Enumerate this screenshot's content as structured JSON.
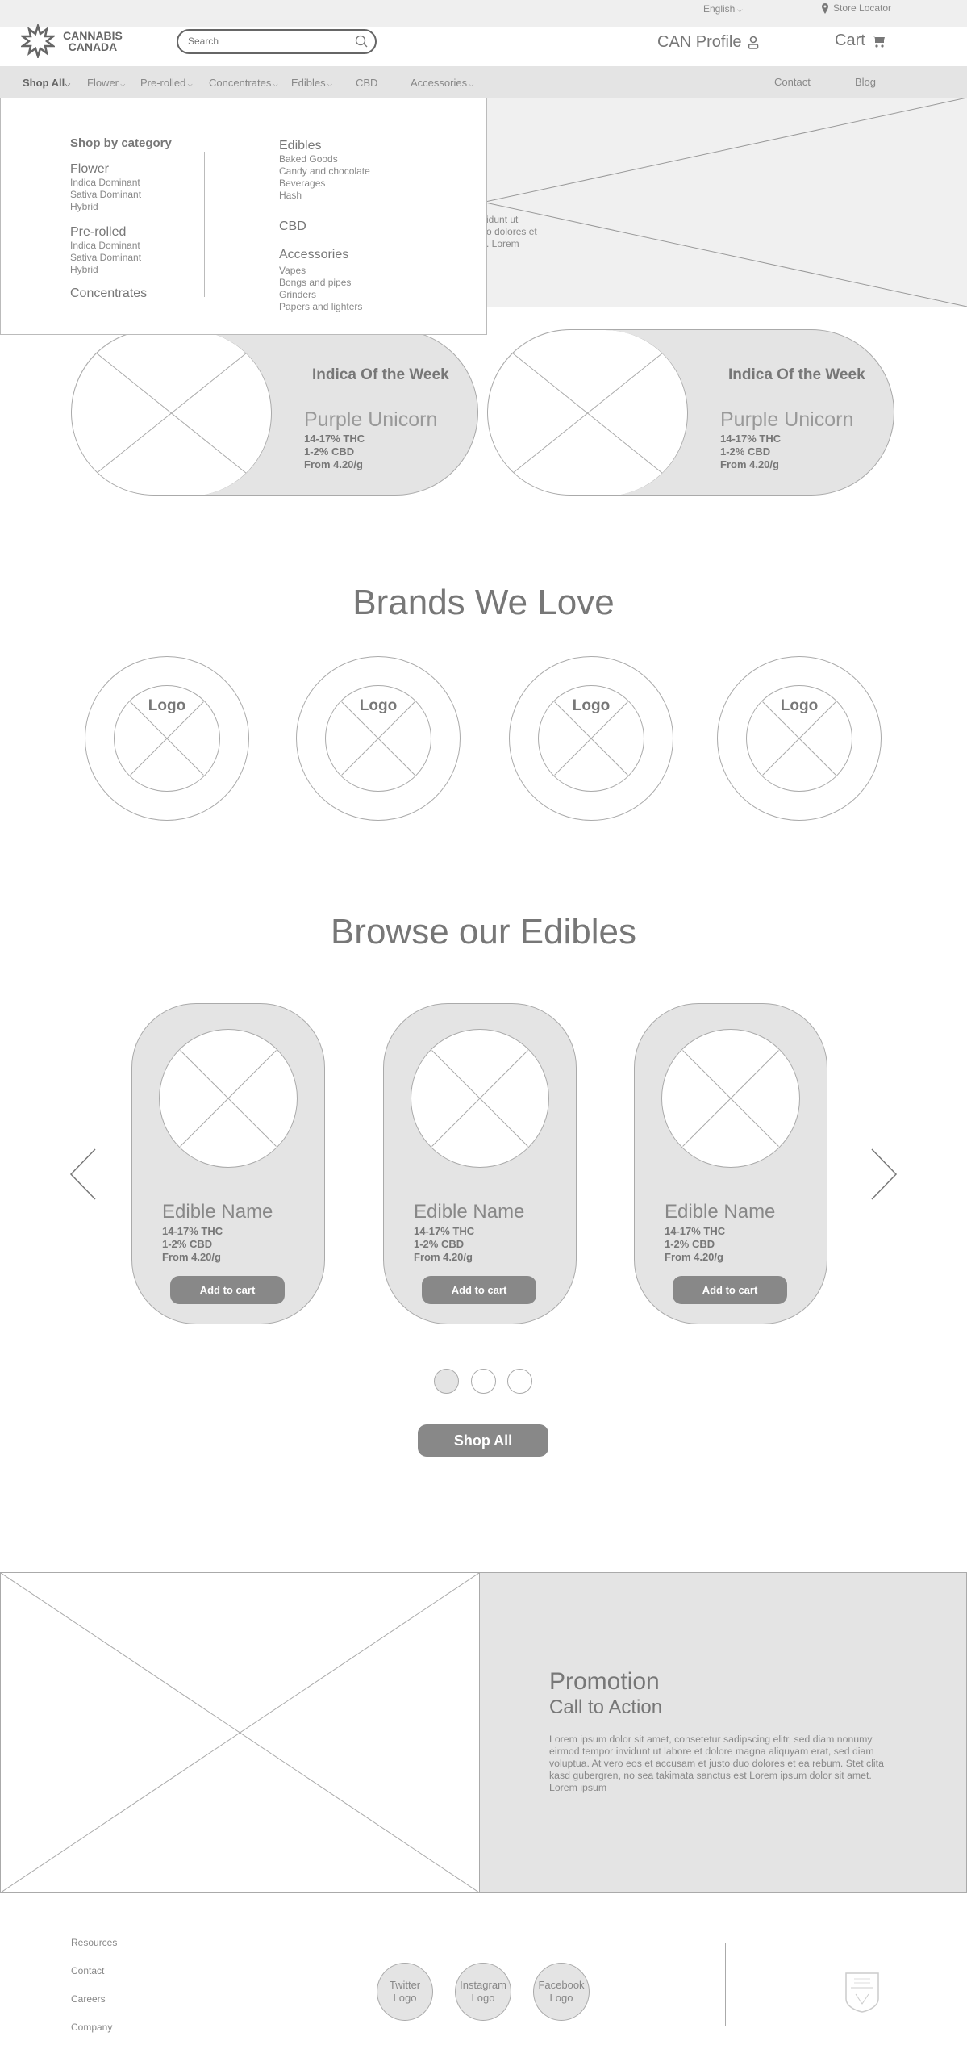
{
  "topbar": {
    "language": "English",
    "store_locator": "Store Locator"
  },
  "header": {
    "logo_line1": "CANNABIS",
    "logo_line2": "CANADA",
    "search_placeholder": "Search",
    "profile": "CAN Profile",
    "cart": "Cart"
  },
  "nav": {
    "items": [
      "Shop All",
      "Flower",
      "Pre-rolled",
      "Concentrates",
      "Edibles",
      "CBD",
      "Accessories"
    ],
    "right": [
      "Contact",
      "Blog"
    ]
  },
  "dropdown": {
    "heading": "Shop by category",
    "left": [
      {
        "title": "Flower",
        "items": [
          "Indica Dominant",
          "Sativa Dominant",
          "Hybrid"
        ]
      },
      {
        "title": "Pre-rolled",
        "items": [
          "Indica Dominant",
          "Sativa Dominant",
          "Hybrid"
        ]
      },
      {
        "title": "Concentrates",
        "items": []
      }
    ],
    "right": [
      {
        "title": "Edibles",
        "items": [
          "Baked Goods",
          "Candy and chocolate",
          "Beverages",
          "Hash"
        ]
      },
      {
        "title": "CBD",
        "items": []
      },
      {
        "title": "Accessories",
        "items": [
          "Vapes",
          "Bongs and pipes",
          "Grinders",
          "Papers and lighters"
        ]
      }
    ]
  },
  "hero": {
    "text_fragments": [
      "idunt ut",
      "o dolores et",
      ". Lorem"
    ]
  },
  "featured": [
    {
      "label": "Indica Of the Week",
      "name": "Purple Unicorn",
      "thc": "14-17% THC",
      "cbd": "1-2% CBD",
      "price": "From 4.20/g"
    },
    {
      "label": "Indica Of the Week",
      "name": "Purple Unicorn",
      "thc": "14-17% THC",
      "cbd": "1-2% CBD",
      "price": "From 4.20/g"
    }
  ],
  "brands": {
    "title": "Brands We Love",
    "logos": [
      "Logo",
      "Logo",
      "Logo",
      "Logo"
    ]
  },
  "edibles": {
    "title": "Browse our Edibles",
    "items": [
      {
        "name": "Edible Name",
        "thc": "14-17% THC",
        "cbd": "1-2% CBD",
        "price": "From 4.20/g",
        "button": "Add to cart"
      },
      {
        "name": "Edible Name",
        "thc": "14-17% THC",
        "cbd": "1-2% CBD",
        "price": "From 4.20/g",
        "button": "Add to cart"
      },
      {
        "name": "Edible Name",
        "thc": "14-17% THC",
        "cbd": "1-2% CBD",
        "price": "From 4.20/g",
        "button": "Add to cart"
      }
    ],
    "active_page": 1,
    "pages": 3,
    "shop_all": "Shop All"
  },
  "promo": {
    "title": "Promotion",
    "subtitle": "Call to Action",
    "body": "Lorem ipsum dolor sit amet, consetetur sadipscing elitr, sed diam nonumy eirmod tempor invidunt ut labore et dolore magna aliquyam erat, sed diam voluptua. At vero eos et accusam et justo duo dolores et ea rebum. Stet clita kasd gubergren, no sea takimata sanctus est Lorem ipsum dolor sit amet. Lorem ipsum"
  },
  "footer": {
    "links": [
      "Resources",
      "Contact",
      "Careers",
      "Company"
    ],
    "social": [
      "Twitter Logo",
      "Instagram Logo",
      "Facebook Logo"
    ]
  }
}
